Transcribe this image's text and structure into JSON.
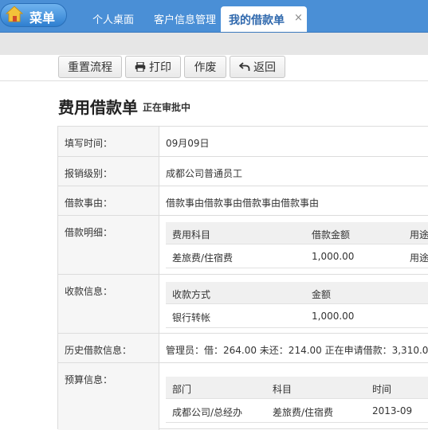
{
  "topbar": {
    "menu_label": "菜单",
    "tabs": [
      "个人桌面",
      "客户信息管理"
    ],
    "active_tab": "我的借款单",
    "close_glyph": "×",
    "colors": {
      "bar": "#4a8fd6",
      "active_text": "#2f68ad"
    }
  },
  "toolbar": {
    "reset_label": "重置流程",
    "print_label": "打印",
    "void_label": "作废",
    "back_label": "返回"
  },
  "page": {
    "title": "费用借款单",
    "status": "正在审批中"
  },
  "form": {
    "fill_time_label": "填写时间：",
    "fill_time_value": "09月09日",
    "level_label": "报销级别：",
    "level_value": "成都公司普通员工",
    "reason_label": "借款事由：",
    "reason_value": "借款事由借款事由借款事由借款事由",
    "detail_label": "借款明细：",
    "detail_headers": [
      "费用科目",
      "借款金额",
      "用途"
    ],
    "detail_row": [
      "差旅费/住宿费",
      "1,000.00",
      "用途"
    ],
    "payment_label": "收款信息：",
    "payment_headers": [
      "收款方式",
      "金额"
    ],
    "payment_row": [
      "银行转帐",
      "1,000.00"
    ],
    "history_label": "历史借款信息：",
    "history_value": "管理员：借：264.00   未还：214.00   正在申请借款：3,310.0",
    "budget_label": "预算信息：",
    "budget_headers": [
      "部门",
      "科目",
      "时间"
    ],
    "budget_row": [
      "成都公司/总经办",
      "差旅费/住宿费",
      "2013-09"
    ]
  }
}
